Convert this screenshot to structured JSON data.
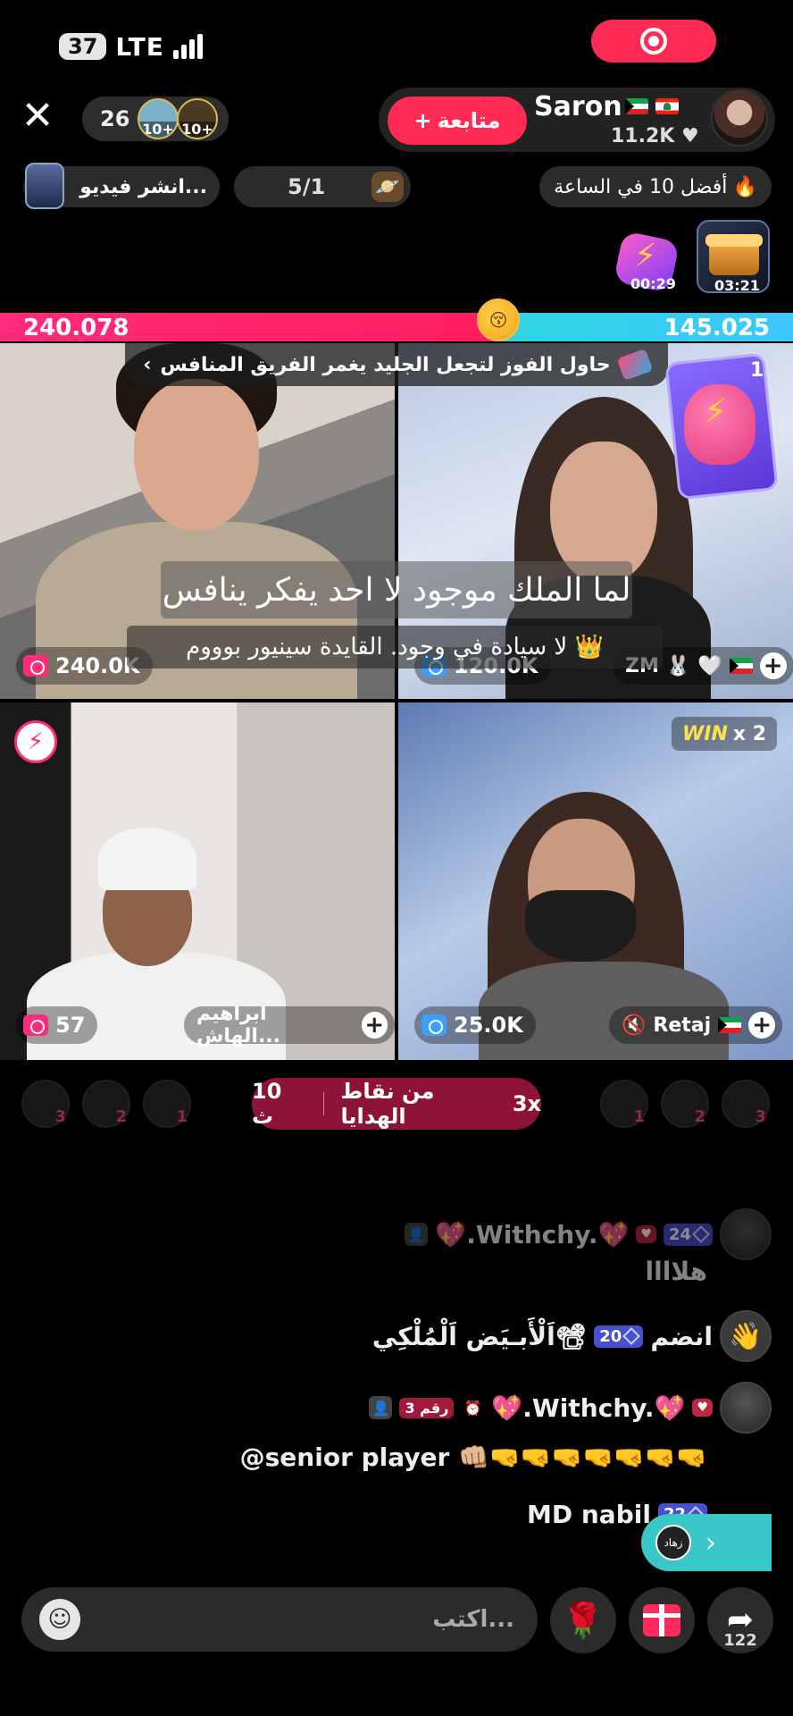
{
  "status_bar": {
    "battery": "37",
    "network": "LTE"
  },
  "header": {
    "close": "✕",
    "viewer_count": "26",
    "viewer_avatar_levels": [
      "10+",
      "10+"
    ],
    "follow_label": "متابعة",
    "host_name": "Saron",
    "host_likes": "11.2K",
    "colors": {
      "accent": "#ff2b54"
    }
  },
  "info_row": {
    "top10_label": "أفضل 10 في الساعة",
    "battle_ratio": "5/1",
    "share_video_label": "انشر فيديو..."
  },
  "gift_boxes": [
    {
      "timer": "00:29",
      "icon": "lightning-box-icon"
    },
    {
      "timer": "03:21",
      "icon": "treasure-chest-icon"
    }
  ],
  "battle": {
    "left_score": "240.078",
    "right_score": "145.025",
    "left_share": 0.623,
    "challenge_text": "حاول الفوز لتجعل الجليد يغمر الفريق المنافس",
    "challenge_chevron": "‹"
  },
  "tiles": [
    {
      "score": "240.0K"
    },
    {
      "score": "120.0K",
      "name": "ZM",
      "card_count": "1"
    },
    {
      "score": "57",
      "name": "ابراهيم الهاش..."
    },
    {
      "score": "25.0K",
      "name": "Retaj",
      "win_label": "WIN",
      "win_multiplier": "x 2"
    }
  ],
  "subtitles": {
    "line1": "لما الملك موجود لا احد يفكر ينافس",
    "line2": "لا سيادة في وجود. القايدة سينيور بوووم 👑"
  },
  "gift_points": {
    "multiplier": "3x",
    "label": "من نقاط الهدايا",
    "timer": "10 ث"
  },
  "rank_left": [
    "3",
    "2",
    "1"
  ],
  "rank_right": [
    "1",
    "2",
    "3"
  ],
  "chat": [
    {
      "user": "💖.Withchy.💖",
      "level": "24",
      "message": "هلاااا",
      "faded": true
    },
    {
      "user": "اَلْأَبـيَض اَلْمُلْكِي📽",
      "level": "20",
      "action": "انضم"
    },
    {
      "user": "💖.Withchy.💖",
      "rank": "رقم 3",
      "message": "@senior player 👊🏼🤜🤜🤜🤜🤜🤜🤜"
    },
    {
      "user": "MD nabil",
      "level": "22"
    }
  ],
  "cohost": {
    "avatar_text": "زهاد"
  },
  "bottom_bar": {
    "comment_placeholder": "اكتب...",
    "share_count": "122"
  }
}
